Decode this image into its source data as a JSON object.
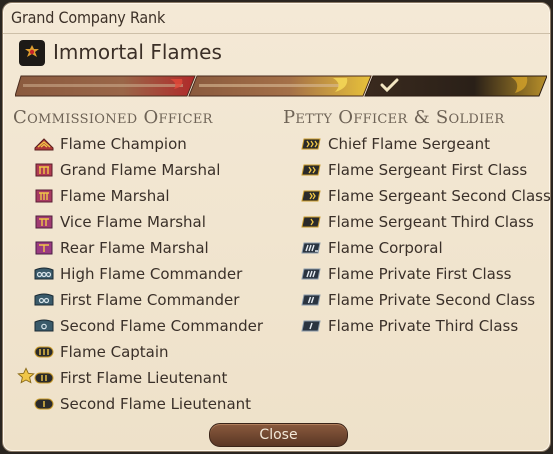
{
  "window": {
    "title": "Grand Company Rank",
    "close_label": "Close"
  },
  "company": {
    "name": "Immortal Flames",
    "icon": "immortal-flames-crest-icon"
  },
  "progress": {
    "segments_total": 3,
    "segments_done": 2,
    "current_marker": "checkmark-icon"
  },
  "colors": {
    "accent_red": "#c8242a",
    "gold": "#e8c23a",
    "banner_brown": "#7a4a32",
    "panel": "#f1e5cf"
  },
  "commissioned": {
    "heading": "Commissioned Officer",
    "ranks": [
      {
        "label": "Flame Champion",
        "icon": "flame-champion-insignia-icon"
      },
      {
        "label": "Grand Flame Marshal",
        "icon": "grand-flame-marshal-insignia-icon"
      },
      {
        "label": "Flame Marshal",
        "icon": "flame-marshal-insignia-icon"
      },
      {
        "label": "Vice Flame Marshal",
        "icon": "vice-flame-marshal-insignia-icon"
      },
      {
        "label": "Rear Flame Marshal",
        "icon": "rear-flame-marshal-insignia-icon"
      },
      {
        "label": "High Flame Commander",
        "icon": "high-flame-commander-insignia-icon"
      },
      {
        "label": "First Flame Commander",
        "icon": "first-flame-commander-insignia-icon"
      },
      {
        "label": "Second Flame Commander",
        "icon": "second-flame-commander-insignia-icon"
      },
      {
        "label": "Flame Captain",
        "icon": "flame-captain-insignia-icon"
      },
      {
        "label": "First Flame Lieutenant",
        "icon": "first-flame-lieutenant-insignia-icon",
        "current": true
      },
      {
        "label": "Second Flame Lieutenant",
        "icon": "second-flame-lieutenant-insignia-icon"
      }
    ]
  },
  "petty": {
    "heading": "Petty Officer & Soldier",
    "ranks": [
      {
        "label": "Chief Flame Sergeant",
        "icon": "chief-flame-sergeant-insignia-icon"
      },
      {
        "label": "Flame Sergeant First Class",
        "icon": "flame-sergeant-first-class-insignia-icon"
      },
      {
        "label": "Flame Sergeant Second Class",
        "icon": "flame-sergeant-second-class-insignia-icon"
      },
      {
        "label": "Flame Sergeant Third Class",
        "icon": "flame-sergeant-third-class-insignia-icon"
      },
      {
        "label": "Flame Corporal",
        "icon": "flame-corporal-insignia-icon"
      },
      {
        "label": "Flame Private First Class",
        "icon": "flame-private-first-class-insignia-icon"
      },
      {
        "label": "Flame Private Second Class",
        "icon": "flame-private-second-class-insignia-icon"
      },
      {
        "label": "Flame Private Third Class",
        "icon": "flame-private-third-class-insignia-icon"
      }
    ]
  }
}
